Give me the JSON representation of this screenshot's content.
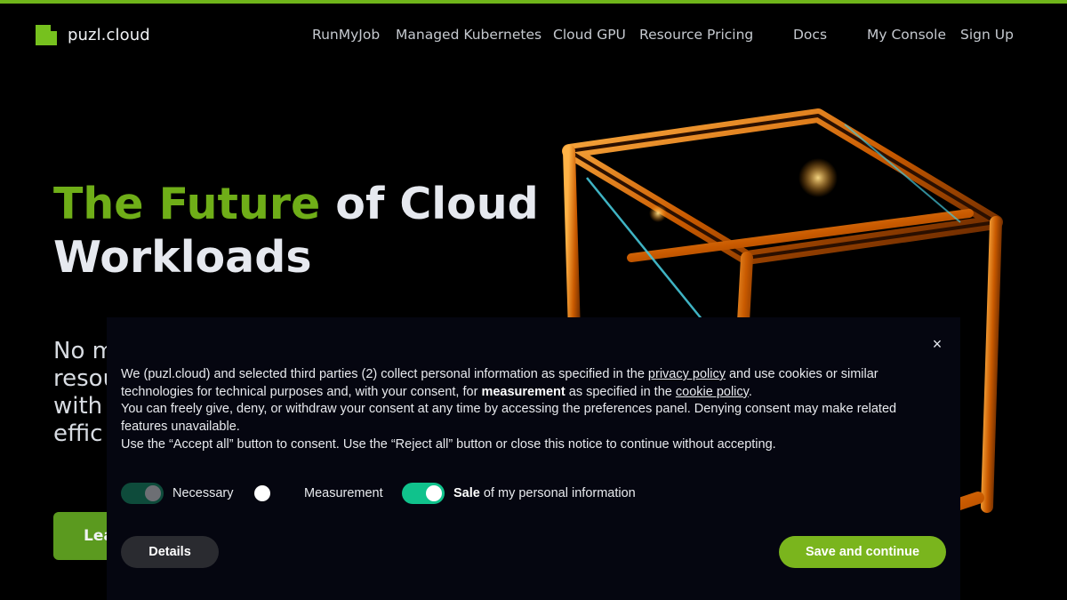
{
  "brand": {
    "name": "puzl.cloud",
    "accent": "#76c11e"
  },
  "nav": {
    "items": [
      {
        "label": "RunMyJob"
      },
      {
        "label": "Managed Kubernetes"
      },
      {
        "label": "Cloud GPU"
      },
      {
        "label": "Resource Pricing"
      },
      {
        "label": "Docs"
      },
      {
        "label": "My Console"
      },
      {
        "label": "Sign Up"
      }
    ]
  },
  "hero": {
    "title_accent": "The Future",
    "title_rest_1": " of Cloud",
    "title_rest_2": "Workloads",
    "subtitle_lines": [
      "No m",
      "resou",
      "with",
      "effic"
    ],
    "cta_label": "Lea"
  },
  "consent": {
    "close_label": "×",
    "p1_a": "We (puzl.cloud) and selected third parties (2) collect personal information as specified in the ",
    "p1_link1": "privacy policy",
    "p1_b": " and use cookies or similar technologies for technical purposes and, with your consent, for ",
    "p1_bold": "measurement",
    "p1_c": " as specified in the ",
    "p1_link2": "cookie policy",
    "p1_d": ".",
    "p2": "You can freely give, deny, or withdraw your consent at any time by accessing the preferences panel. Denying consent may make related features unavailable.",
    "p3": "Use the “Accept all” button to consent. Use the “Reject all” button or close this notice to continue without accepting.",
    "toggles": {
      "necessary": "Necessary",
      "measurement": "Measurement",
      "sale_bold": "Sale",
      "sale_rest": " of my personal information"
    },
    "details_label": "Details",
    "save_label": "Save and continue"
  }
}
